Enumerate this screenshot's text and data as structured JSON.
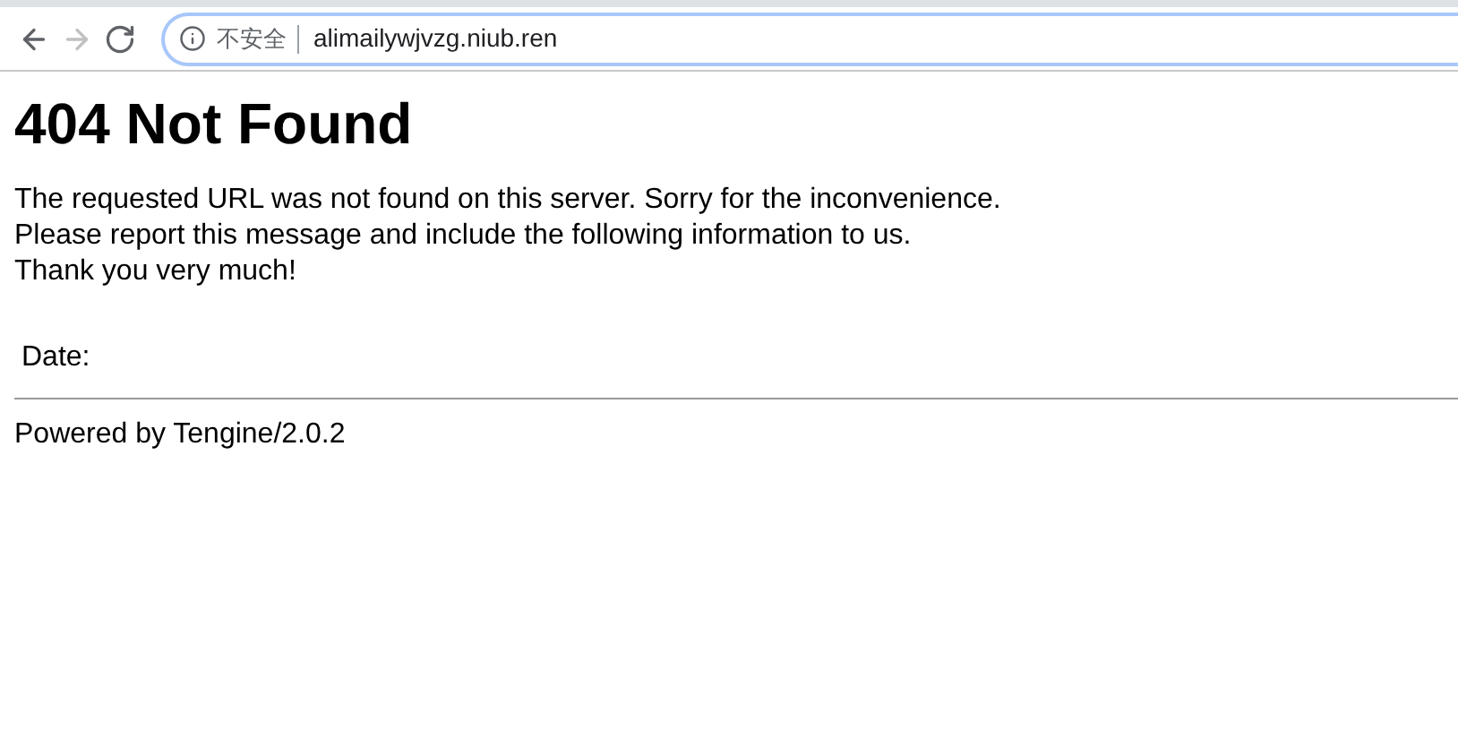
{
  "toolbar": {
    "nav_buttons": [
      {
        "kind": "back",
        "disabled": false
      },
      {
        "kind": "forward",
        "disabled": true
      },
      {
        "kind": "reload",
        "disabled": false
      }
    ],
    "address_bar": {
      "security_label": "不安全",
      "url": "alimailywjvzg.niub.ren"
    }
  },
  "page": {
    "heading": "404 Not Found",
    "paragraph_lines": [
      "The requested URL was not found on this server. Sorry for the inconvenience.",
      "Please report this message and include the following information to us.",
      "Thank you very much!"
    ],
    "date_label": "Date:",
    "footer": "Powered by Tengine/2.0.2"
  }
}
